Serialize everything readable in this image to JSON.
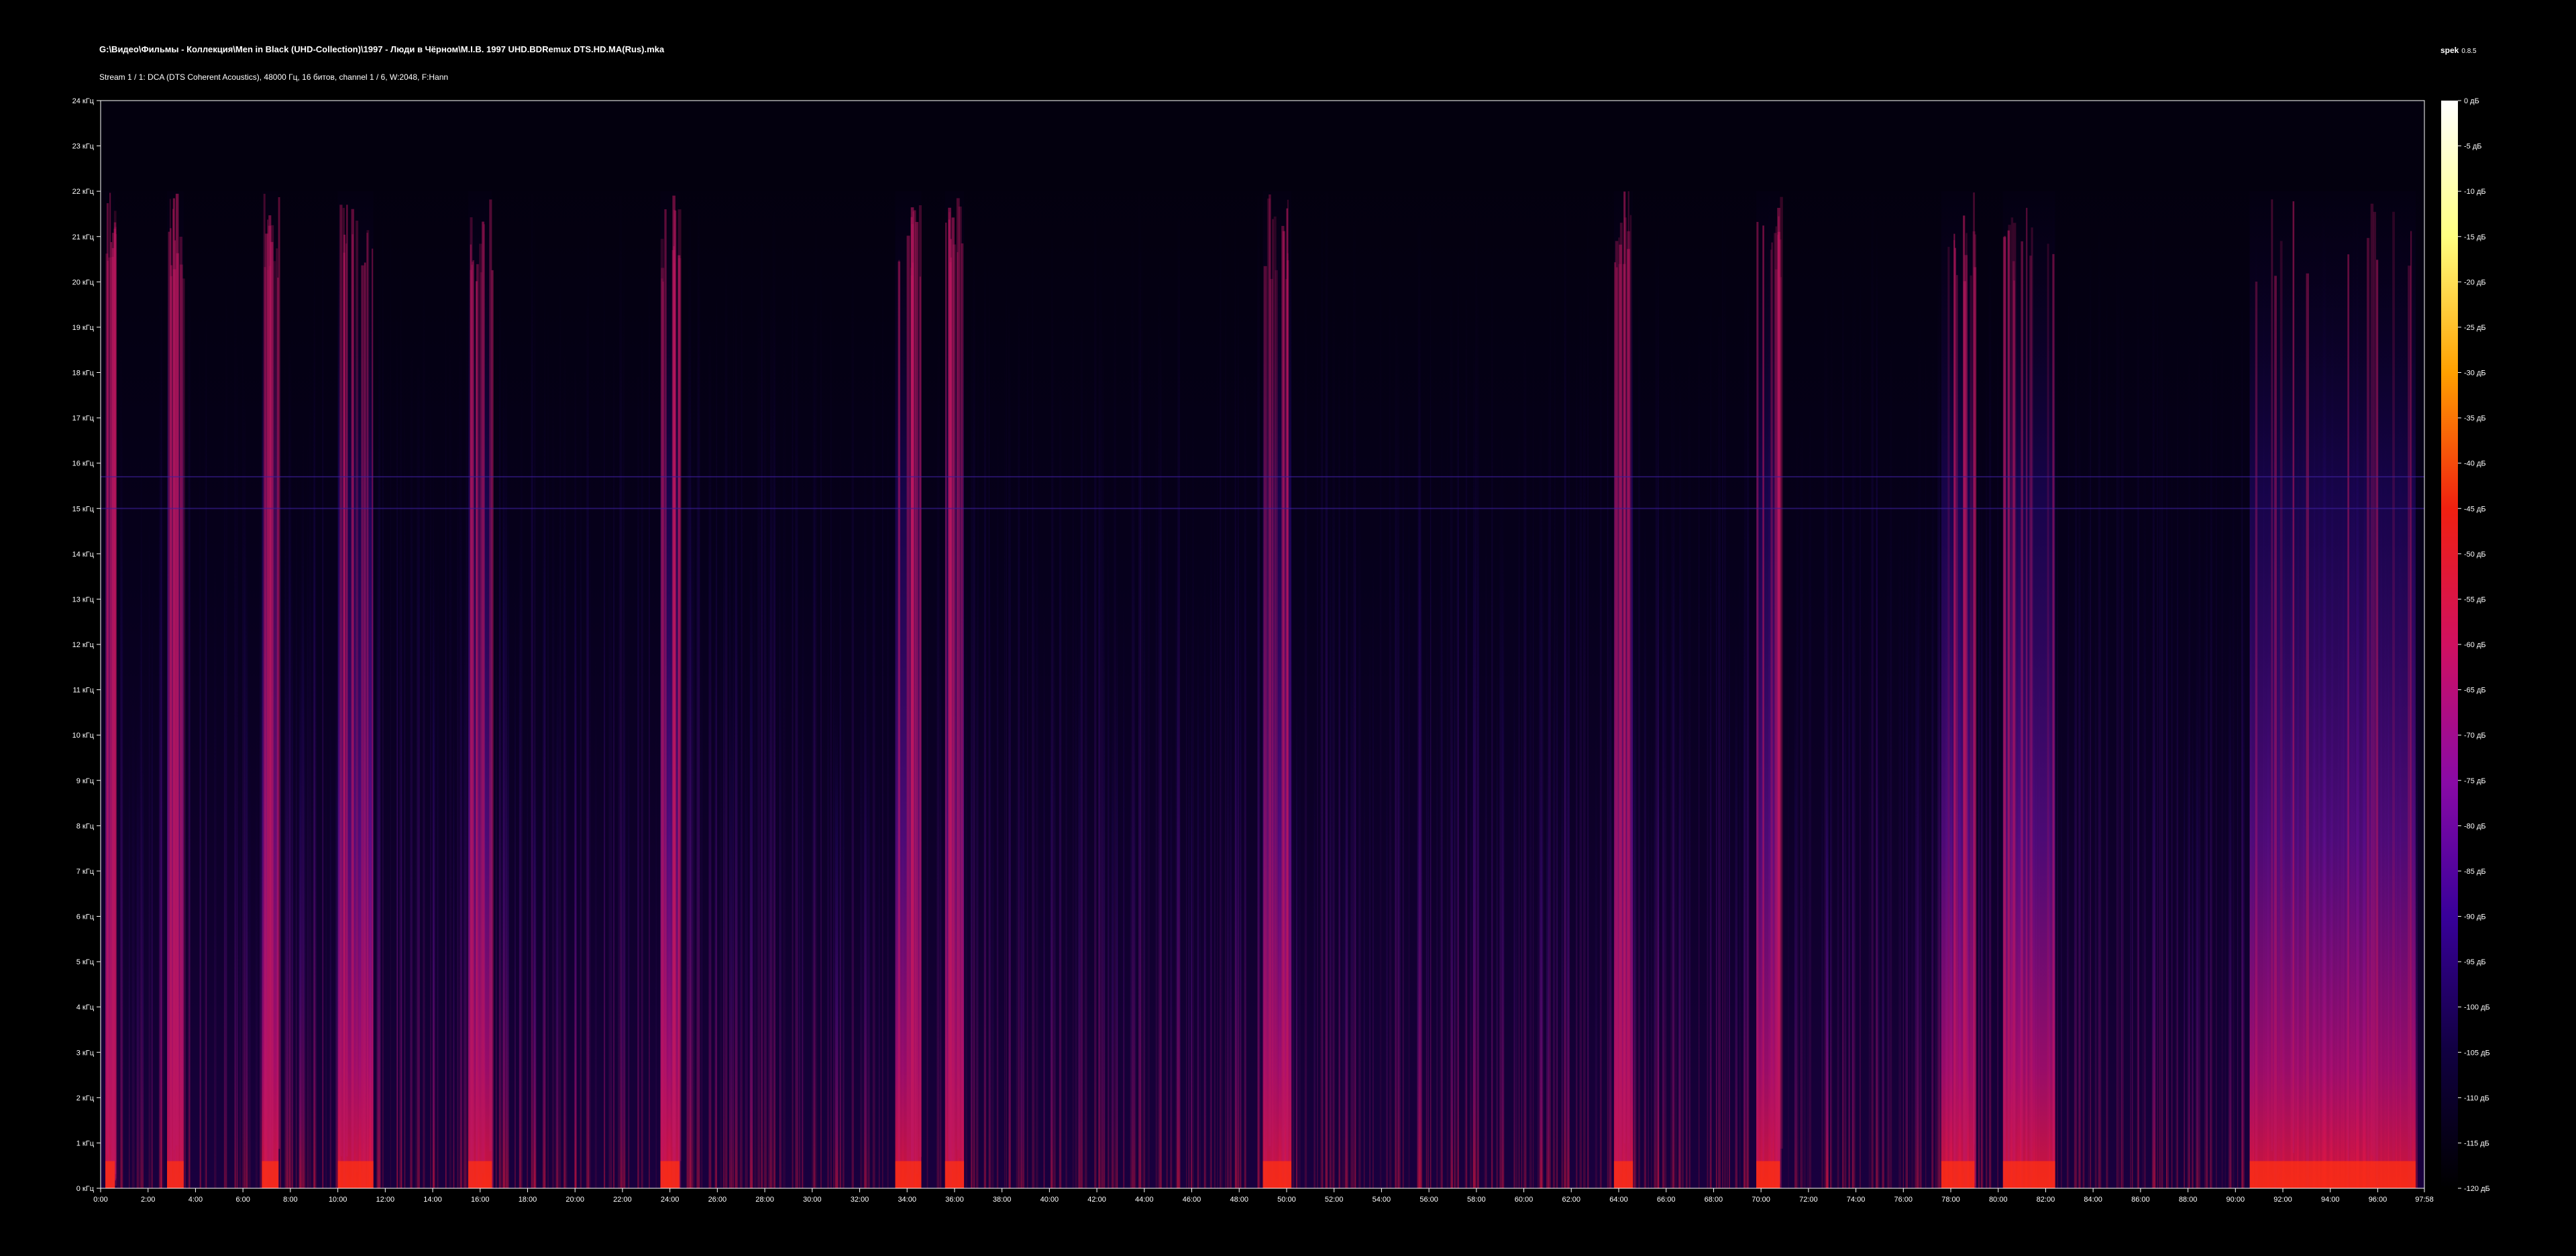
{
  "header": {
    "file_path": "G:\\Видео\\Фильмы - Коллекция\\Men in Black (UHD-Collection)\\1997 - Люди в Чёрном\\M.I.B. 1997 UHD.BDRemux DTS.HD.MA(Rus).mka",
    "stream_info": "Stream 1 / 1: DCA (DTS Coherent Acoustics), 48000 Гц, 16 битов, channel 1 / 6, W:2048, F:Hann",
    "app_name": "spek",
    "app_version": "0.8.5"
  },
  "colors": {
    "background": "#000000",
    "axis": "#ffffff",
    "palette": [
      "#000000",
      "#100040",
      "#38009a",
      "#8a0aa6",
      "#d01060",
      "#f02010",
      "#ffa000",
      "#ffff80",
      "#ffffff"
    ]
  },
  "chart_data": {
    "type": "heatmap",
    "title": "",
    "xlabel": "",
    "ylabel": "",
    "x_unit": "min:sec",
    "xlim": [
      "0:00",
      "97:58"
    ],
    "x_ticks": [
      "0:00",
      "2:00",
      "4:00",
      "6:00",
      "8:00",
      "10:00",
      "12:00",
      "14:00",
      "16:00",
      "18:00",
      "20:00",
      "22:00",
      "24:00",
      "26:00",
      "28:00",
      "30:00",
      "32:00",
      "34:00",
      "36:00",
      "38:00",
      "40:00",
      "42:00",
      "44:00",
      "46:00",
      "48:00",
      "50:00",
      "52:00",
      "54:00",
      "56:00",
      "58:00",
      "60:00",
      "62:00",
      "64:00",
      "66:00",
      "68:00",
      "70:00",
      "72:00",
      "74:00",
      "76:00",
      "78:00",
      "80:00",
      "82:00",
      "84:00",
      "86:00",
      "88:00",
      "90:00",
      "92:00",
      "94:00",
      "96:00",
      "97:58"
    ],
    "y_unit": "кГц",
    "ylim": [
      0,
      24
    ],
    "y_ticks": [
      "0 кГц",
      "1 кГц",
      "2 кГц",
      "3 кГц",
      "4 кГц",
      "5 кГц",
      "6 кГц",
      "7 кГц",
      "8 кГц",
      "9 кГц",
      "10 кГц",
      "11 кГц",
      "12 кГц",
      "13 кГц",
      "14 кГц",
      "15 кГц",
      "16 кГц",
      "17 кГц",
      "18 кГц",
      "19 кГц",
      "20 кГц",
      "21 кГц",
      "22 кГц",
      "23 кГц",
      "24 кГц"
    ],
    "colorbar": {
      "unit": "дБ",
      "range": [
        -120,
        0
      ],
      "ticks": [
        "0 дБ",
        "-5 дБ",
        "-10 дБ",
        "-15 дБ",
        "-20 дБ",
        "-25 дБ",
        "-30 дБ",
        "-35 дБ",
        "-40 дБ",
        "-45 дБ",
        "-50 дБ",
        "-55 дБ",
        "-60 дБ",
        "-65 дБ",
        "-70 дБ",
        "-75 дБ",
        "-80 дБ",
        "-85 дБ",
        "-90 дБ",
        "-95 дБ",
        "-100 дБ",
        "-105 дБ",
        "-110 дБ",
        "-115 дБ",
        "-120 дБ"
      ]
    },
    "sustained_tone_khz": [
      15.7,
      15.0
    ],
    "high_energy_minutes": [
      [
        0.2,
        0.6
      ],
      [
        2.8,
        3.5
      ],
      [
        6.8,
        7.5
      ],
      [
        10.0,
        11.5
      ],
      [
        15.5,
        16.5
      ],
      [
        23.6,
        24.4
      ],
      [
        33.5,
        34.6
      ],
      [
        35.6,
        36.4
      ],
      [
        49.0,
        50.2
      ],
      [
        63.8,
        64.6
      ],
      [
        69.8,
        70.8
      ],
      [
        77.6,
        79.0
      ],
      [
        80.2,
        82.4
      ],
      [
        90.6,
        97.6
      ]
    ]
  }
}
